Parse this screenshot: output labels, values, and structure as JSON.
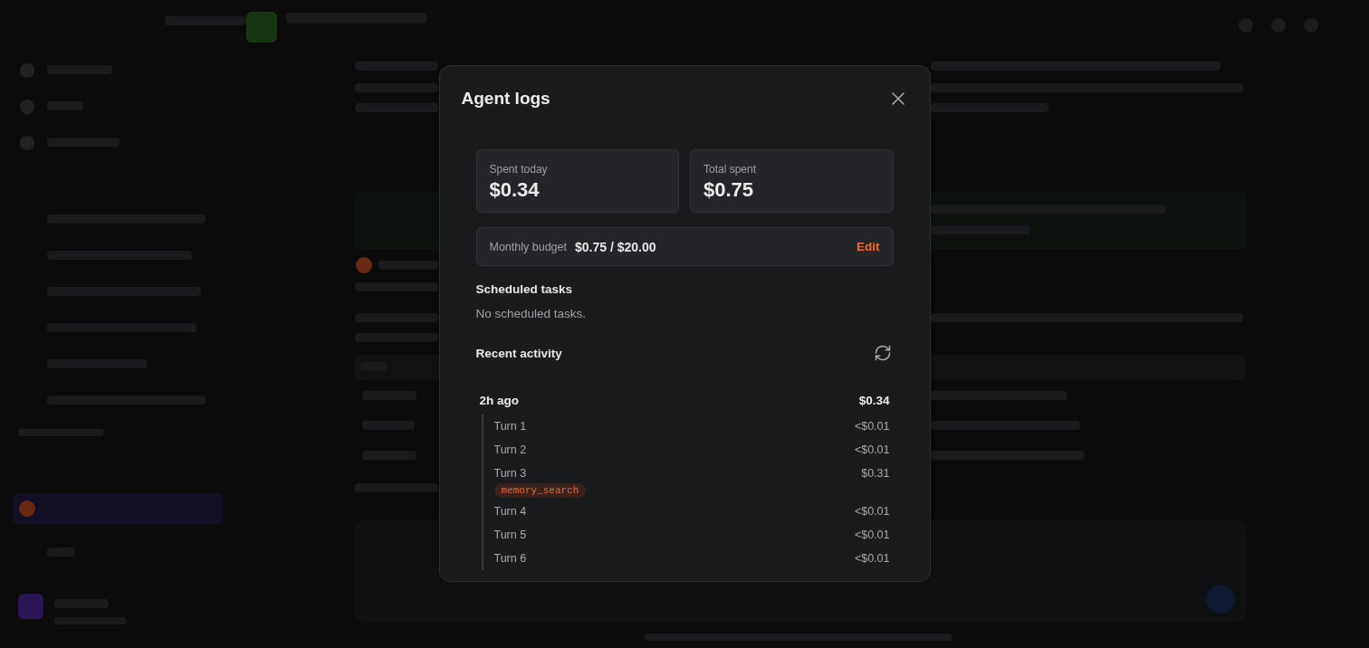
{
  "dialog": {
    "title": "Agent logs",
    "stats": [
      {
        "label": "Spent today",
        "value": "$0.34"
      },
      {
        "label": "Total spent",
        "value": "$0.75"
      }
    ],
    "budget": {
      "label": "Monthly budget",
      "value": "$0.75 / $20.00",
      "action": "Edit"
    },
    "scheduled_tasks": {
      "heading": "Scheduled tasks",
      "empty_text": "No scheduled tasks."
    },
    "recent_activity": {
      "heading": "Recent activity",
      "groups": [
        {
          "time": "2h ago",
          "total": "$0.34",
          "turns": [
            {
              "label": "Turn 1",
              "cost": "<$0.01"
            },
            {
              "label": "Turn 2",
              "cost": "<$0.01"
            },
            {
              "label": "Turn 3",
              "cost": "$0.31",
              "tools": [
                "memory_search"
              ]
            },
            {
              "label": "Turn 4",
              "cost": "<$0.01"
            },
            {
              "label": "Turn 5",
              "cost": "<$0.01"
            },
            {
              "label": "Turn 6",
              "cost": "<$0.01"
            }
          ]
        }
      ]
    }
  }
}
